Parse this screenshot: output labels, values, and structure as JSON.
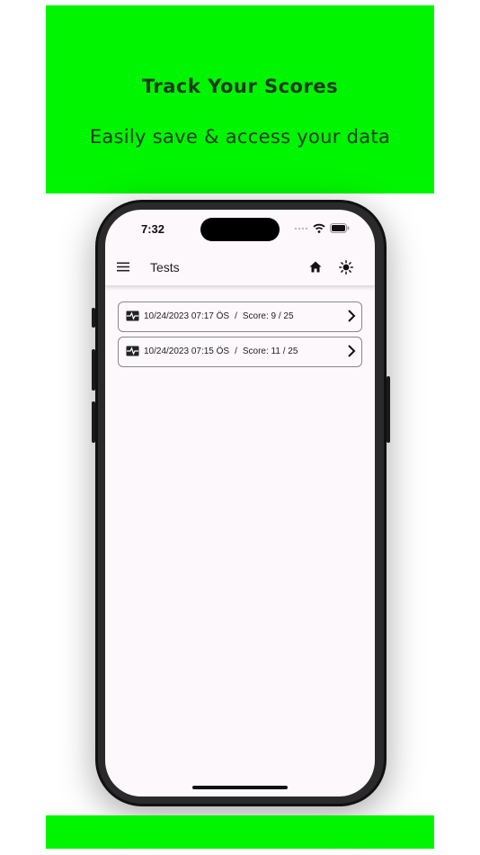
{
  "banner": {
    "title": "Track Your Scores",
    "subtitle": "Easily save & access your data",
    "color": "#00f500"
  },
  "status_bar": {
    "time": "7:32"
  },
  "app_bar": {
    "title": "Tests",
    "icons": [
      "menu-icon",
      "home-icon",
      "brightness-icon"
    ]
  },
  "tests": [
    {
      "datetime": "10/24/2023 07:17 ÖS",
      "separator": "/",
      "score": "Score: 9 / 25"
    },
    {
      "datetime": "10/24/2023 07:15 ÖS",
      "separator": "/",
      "score": "Score: 11 / 25"
    }
  ]
}
